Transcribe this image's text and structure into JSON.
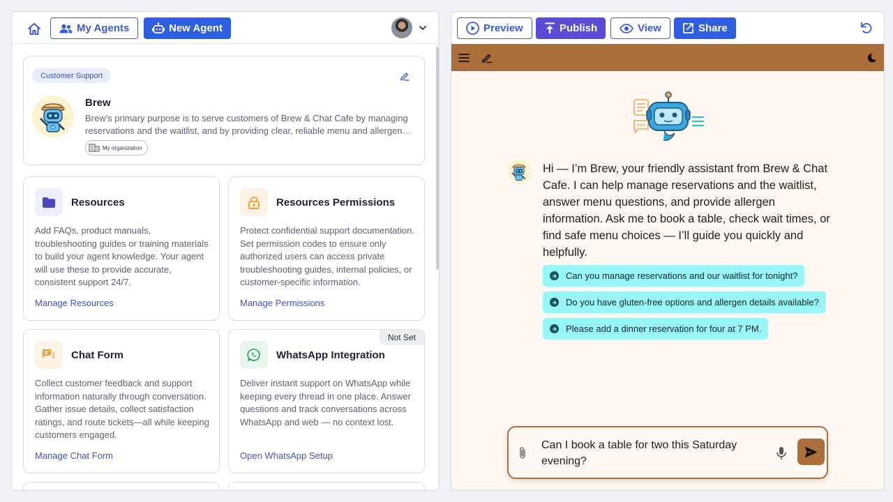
{
  "left_toolbar": {
    "my_agents_label": "My Agents",
    "new_agent_label": "New Agent"
  },
  "agent": {
    "tag": "Customer Support",
    "name": "Brew",
    "description": "Brew's primary purpose is to serve customers of Brew & Chat Cafe by managing reservations and the waitlist, and by providing clear, reliable menu and allergen information.",
    "org_label": "My organization"
  },
  "features": [
    {
      "title": "Resources",
      "description": "Add FAQs, product manuals, troubleshooting guides or training materials to build your agent knowledge. Your agent will use these to provide accurate, consistent support 24/7.",
      "link": "Manage Resources"
    },
    {
      "title": "Resources Permissions",
      "description": "Protect confidential support documentation. Set permission codes to ensure only authorized users can access private troubleshooting guides, internal policies, or customer-specific information.",
      "link": "Manage Permissions"
    },
    {
      "title": "Chat Form",
      "description": "Collect customer feedback and support information naturally through conversation. Gather issue details, collect satisfaction ratings, and route tickets—all while keeping customers engaged.",
      "link": "Manage Chat Form"
    },
    {
      "title": "WhatsApp Integration",
      "description": "Deliver instant support on WhatsApp while keeping every thread in one place. Answer questions and track conversations across WhatsApp and web — no context lost.",
      "link": "Open WhatsApp Setup",
      "badge": "Not Set"
    }
  ],
  "right_toolbar": {
    "preview_label": "Preview",
    "publish_label": "Publish",
    "view_label": "View",
    "share_label": "Share"
  },
  "chat": {
    "bar_color": "#ac6e3a",
    "greeting": "Hi — I’m Brew, your friendly assistant from Brew & Chat Cafe. I can help manage reservations and the waitlist, answer menu questions, and provide allergen information. Ask me to book a table, check wait times, or find safe menu choices — I’ll guide you quickly and helpfully.",
    "suggestions": [
      "Can you manage reservations and our waitlist for tonight?",
      "Do you have gluten-free options and allergen details available?",
      "Please add a dinner reservation for four at 7 PM."
    ],
    "input_value": "Can I book a table for two this Saturday evening?"
  },
  "colors": {
    "primary": "#2f5ee0",
    "publish": "#5b4bd6",
    "accent": "#ac6e3a",
    "suggestion": "#98f6f8"
  }
}
